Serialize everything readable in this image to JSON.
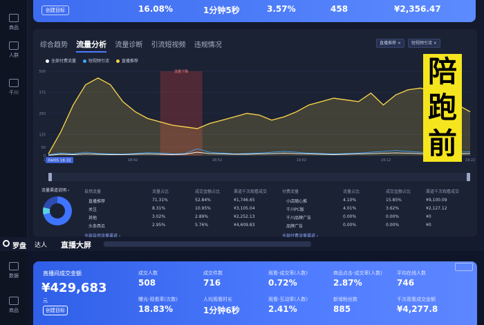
{
  "top": {
    "sidebar": [
      {
        "label": "商品",
        "icon": "bag-icon"
      },
      {
        "label": "人群",
        "icon": "people-icon"
      },
      {
        "label": "千川",
        "icon": "ad-icon"
      }
    ],
    "strip": {
      "detail_button": "创建目标",
      "values": [
        "16.08%",
        "1分钟5秒",
        "3.57%",
        "458",
        "¥2,356.47"
      ]
    },
    "tabs": [
      "综合趋势",
      "流量分析",
      "流量诊断",
      "引流短视频",
      "违规情况"
    ],
    "active_tab": "流量分析",
    "filter_chips": [
      "直播推荐 ×",
      "短视频引流 ×"
    ],
    "legend": [
      {
        "label": "全部付费流量",
        "color": "#ffffff"
      },
      {
        "label": "短视频引流",
        "color": "#3ea6ff"
      },
      {
        "label": "直播推荐",
        "color": "#f2d04a"
      }
    ],
    "date_badge": "04/05 18:32",
    "marker_label": "流量下降",
    "sources": {
      "title": "流量渠道说明 ›",
      "left_headers": [
        "自然流量",
        "流量占比",
        "成交金额占比",
        "渠道千次观看成交"
      ],
      "right_headers": [
        "付费流量",
        "流量占比",
        "成交金额占比",
        "渠道千次观看成交"
      ],
      "left_rows": [
        [
          "直播推荐",
          "71.31%",
          "52.84%",
          "¥1,746.65"
        ],
        [
          "关注",
          "8.31%",
          "10.95%",
          "¥3,105.04"
        ],
        [
          "其他",
          "3.02%",
          "2.89%",
          "¥2,252.13"
        ],
        [
          "头条西瓜",
          "2.95%",
          "5.76%",
          "¥4,609.83"
        ]
      ],
      "right_rows": [
        [
          "小店随心推",
          "4.10%",
          "15.85%",
          "¥9,100.09"
        ],
        [
          "千川PC版",
          "4.01%",
          "3.62%",
          "¥2,127.12"
        ],
        [
          "千川品牌广告",
          "0.00%",
          "0.00%",
          "¥0"
        ],
        [
          "品牌广告",
          "0.00%",
          "0.00%",
          "¥0"
        ]
      ],
      "footer_left": "全部自然流量渠道 ›",
      "footer_right": "全部付费流量渠道 ›"
    }
  },
  "overlay_text": [
    "陪",
    "跑",
    "前"
  ],
  "bottom": {
    "title1": "罗盘",
    "title2": "达人",
    "title3": "直播大屏",
    "sidebar": [
      {
        "label": "数据",
        "icon": "data-icon"
      },
      {
        "label": "商品",
        "icon": "bag-icon"
      }
    ],
    "kpi_main_label": "直播间成交金额",
    "kpi_main_value": "¥429,683",
    "kpi_main_sub": "元",
    "kpi_button": "创建目标",
    "kpis": [
      {
        "label": "成交人数",
        "value": "508"
      },
      {
        "label": "成交件数",
        "value": "716"
      },
      {
        "label": "观看-成交率(人数)",
        "value": "0.72%"
      },
      {
        "label": "商品点击-成交率(人数)",
        "value": "2.87%"
      },
      {
        "label": "平均在线人数",
        "value": "746"
      },
      {
        "label": "曝光-观看率(次数)",
        "value": "18.83%"
      },
      {
        "label": "人均观看时长",
        "value": "1分钟6秒"
      },
      {
        "label": "观看-互动率(人数)",
        "value": "2.41%"
      },
      {
        "label": "新增粉丝数",
        "value": "885"
      },
      {
        "label": "千次观看成交金额",
        "value": "¥4,277.8"
      }
    ]
  },
  "chart_data": {
    "type": "line",
    "x_ticks": [
      "18:32",
      "18:42",
      "18:52",
      "19:02",
      "19:12",
      "19:22"
    ],
    "y_ticks": [
      0,
      50,
      125,
      250,
      375,
      500
    ],
    "ylim": [
      0,
      500
    ],
    "series": [
      {
        "name": "直播推荐",
        "color": "#f2d04a",
        "values": [
          10,
          140,
          300,
          420,
          460,
          420,
          320,
          260,
          220,
          200,
          180,
          170,
          160,
          190,
          210,
          230,
          250,
          240,
          210,
          230,
          260,
          300,
          320,
          340,
          330,
          320,
          370,
          300,
          360,
          390,
          400,
          380,
          330,
          300,
          260
        ]
      },
      {
        "name": "短视频引流",
        "color": "#3ea6ff",
        "values": [
          5,
          15,
          10,
          20,
          12,
          10,
          8,
          12,
          18,
          15,
          10,
          12,
          40,
          20,
          15,
          10,
          12,
          15,
          20,
          25,
          20,
          15,
          12,
          10,
          12,
          15,
          20,
          25,
          30,
          25,
          20,
          18,
          15,
          20,
          22
        ]
      },
      {
        "name": "全部付费流量",
        "color": "#ffffff",
        "values": [
          2,
          8,
          6,
          10,
          8,
          6,
          6,
          8,
          10,
          8,
          6,
          8,
          20,
          12,
          10,
          8,
          8,
          10,
          12,
          14,
          12,
          10,
          8,
          6,
          8,
          10,
          12,
          14,
          16,
          14,
          12,
          10,
          8,
          10,
          12
        ]
      }
    ]
  }
}
